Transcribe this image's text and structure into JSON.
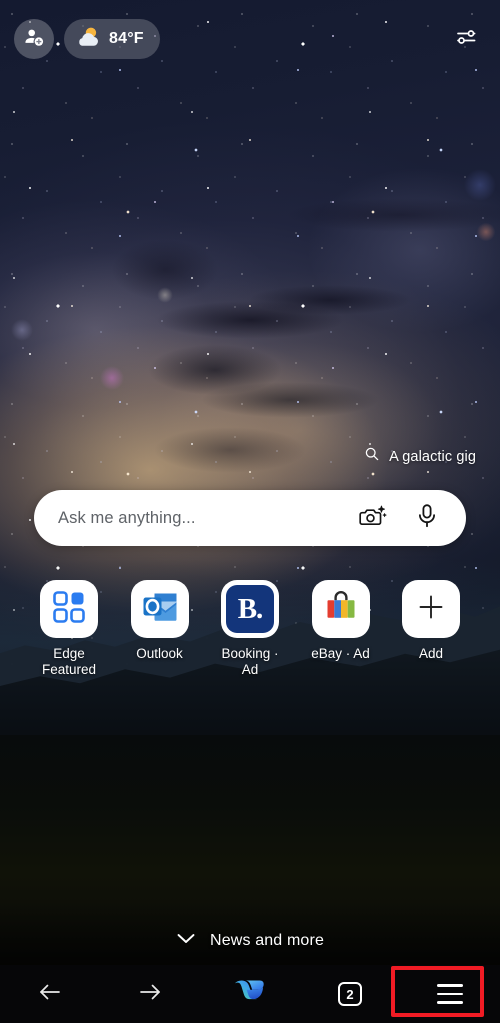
{
  "top_bar": {
    "profile_icon": "add-person-icon",
    "weather": {
      "icon": "sun-behind-cloud-icon",
      "temperature": "84°F"
    },
    "settings_icon": "sliders-icon"
  },
  "background": {
    "caption": {
      "icon": "search-icon",
      "text": "A galactic gig"
    },
    "scene": "milky-way-night-sky-over-desert"
  },
  "search": {
    "placeholder": "Ask me anything...",
    "camera_icon": "camera-sparkle-icon",
    "mic_icon": "microphone-icon"
  },
  "shortcuts": [
    {
      "label": "Edge Featured",
      "icon": "edge-featured-grid-icon"
    },
    {
      "label": "Outlook",
      "icon": "outlook-icon"
    },
    {
      "label": "Booking · Ad",
      "icon": "booking-icon",
      "icon_text": "B."
    },
    {
      "label": "eBay · Ad",
      "icon": "ebay-shopping-bag-icon"
    },
    {
      "label": "Add",
      "icon": "plus-icon"
    }
  ],
  "feed": {
    "chevron_icon": "chevron-down-icon",
    "label": "News and more"
  },
  "bottom_nav": {
    "back_icon": "back-arrow-icon",
    "forward_icon": "forward-arrow-icon",
    "copilot_icon": "copilot-icon",
    "tab_count": "2",
    "menu_icon": "hamburger-menu-icon"
  },
  "annotation": {
    "highlight_color": "#f01b24",
    "highlight_target": "hamburger-menu-icon"
  }
}
